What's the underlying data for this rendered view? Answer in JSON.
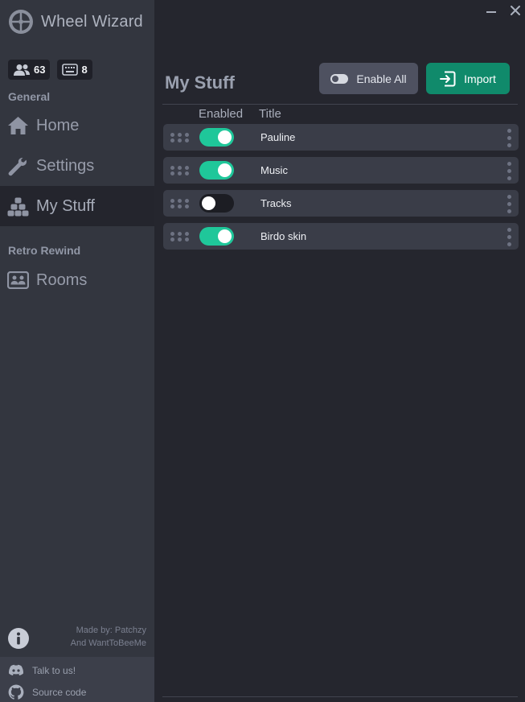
{
  "app": {
    "title": "Wheel Wizard",
    "logo_icon": "wheel-logo-icon"
  },
  "stats": {
    "players": {
      "icon": "players-icon",
      "count": "63"
    },
    "rooms": {
      "icon": "keyboard-icon",
      "count": "8"
    }
  },
  "sidebar": {
    "sections": [
      {
        "label": "General"
      },
      {
        "label": "Retro Rewind"
      }
    ],
    "items": [
      {
        "label": "Home",
        "icon": "home-icon"
      },
      {
        "label": "Settings",
        "icon": "wrench-icon"
      },
      {
        "label": "My Stuff",
        "icon": "cubes-icon",
        "active": true
      },
      {
        "label": "Rooms",
        "icon": "rooms-icon"
      }
    ],
    "credits": {
      "line1": "Made by: Patchzy",
      "line2": "And WantToBeeMe"
    },
    "links": [
      {
        "label": "Talk to us!",
        "icon": "discord-icon"
      },
      {
        "label": "Source code",
        "icon": "github-icon"
      }
    ]
  },
  "window": {
    "minimize_icon": "minimize-icon",
    "close_icon": "close-icon"
  },
  "main": {
    "title": "My Stuff",
    "enable_all_label": "Enable All",
    "import_label": "Import",
    "columns": {
      "enabled": "Enabled",
      "title": "Title"
    },
    "mods": [
      {
        "title": "Pauline",
        "enabled": true
      },
      {
        "title": "Music",
        "enabled": true
      },
      {
        "title": "Tracks",
        "enabled": false
      },
      {
        "title": "Birdo skin",
        "enabled": true
      }
    ]
  },
  "colors": {
    "accent": "#1fc79a",
    "import_button": "#108a6b",
    "sidebar": "#33363f",
    "background": "#25262e"
  }
}
